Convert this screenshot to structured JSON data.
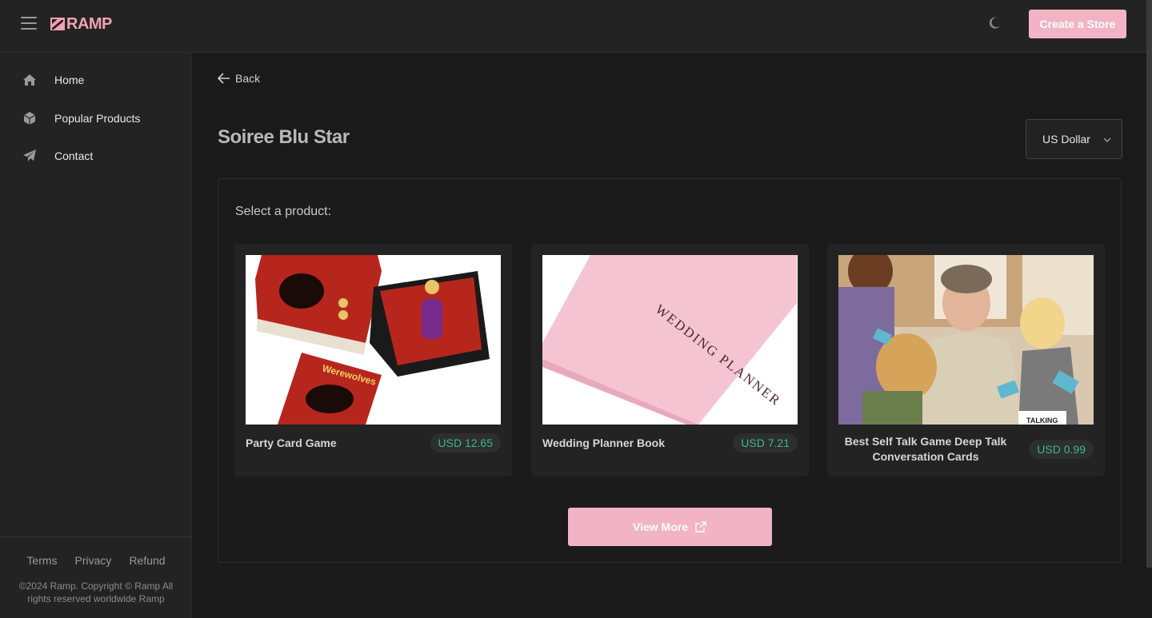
{
  "header": {
    "brand": "RAMP",
    "create_store_label": "Create a Store",
    "accent_color": "#f2b4c5"
  },
  "sidebar": {
    "items": [
      {
        "label": "Home",
        "icon": "home-icon"
      },
      {
        "label": "Popular Products",
        "icon": "box-icon"
      },
      {
        "label": "Contact",
        "icon": "paper-plane-icon"
      }
    ],
    "footer_links": [
      "Terms",
      "Privacy",
      "Refund"
    ],
    "copyright": "©2024 Ramp. Copyright © Ramp All rights reserved worldwide Ramp"
  },
  "main": {
    "back_label": "Back",
    "store_title": "Soiree Blu Star",
    "currency": "US Dollar",
    "select_label": "Select a product:",
    "products": [
      {
        "name": "Party Card Game",
        "price": "USD 12.65"
      },
      {
        "name": "Wedding Planner Book",
        "price": "USD 7.21"
      },
      {
        "name": "Best Self Talk Game Deep Talk Conversation Cards",
        "price": "USD 0.99"
      }
    ],
    "view_more_label": "View More"
  },
  "images": {
    "card1_box_text": "Werewolves",
    "card2_cover_title": "WEDDING PLANNER",
    "card3_box_text": "TALKING"
  }
}
